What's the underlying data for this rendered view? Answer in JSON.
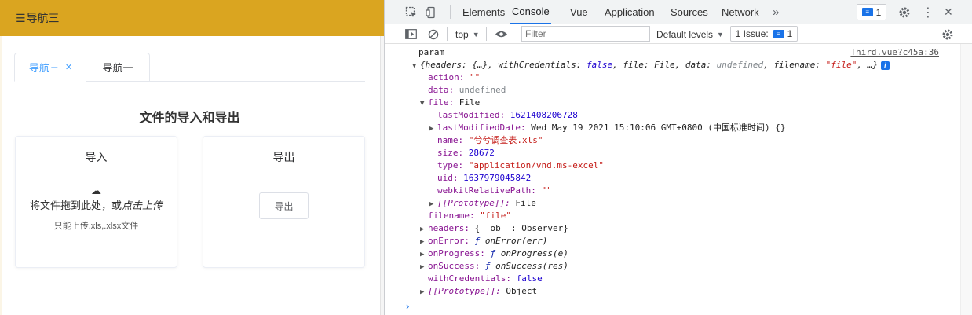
{
  "app": {
    "header_title": "导航三",
    "tabs": [
      {
        "label": "导航三",
        "active": true,
        "closable": true
      },
      {
        "label": "导航一",
        "active": false,
        "closable": false
      }
    ],
    "page_title": "文件的导入和导出",
    "import_card": {
      "title": "导入",
      "drag_text": "将文件拖到此处，或",
      "click_text": "点击上传",
      "tip": "只能上传.xls,.xlsx文件"
    },
    "export_card": {
      "title": "导出",
      "button_label": "导出"
    },
    "colors": {
      "header_bg": "#DAA520",
      "accent": "#409EFF"
    }
  },
  "devtools": {
    "tabs": [
      "Elements",
      "Console",
      "Vue",
      "Application",
      "Sources",
      "Network"
    ],
    "active_tab": "Console",
    "more_label": "»",
    "issues_badge_count": "1",
    "toolbar": {
      "context": "top",
      "filter_placeholder": "Filter",
      "levels": "Default levels",
      "issues_label": "1 Issue:",
      "issues_count": "1"
    },
    "console": {
      "log_label": "param",
      "source_link": "Third.vue?c45a:36",
      "summary": {
        "headers": "headers: {…}",
        "withCredentials_key": "withCredentials:",
        "withCredentials_val": "false",
        "file_key": "file:",
        "file_val": "File",
        "data_key": "data:",
        "data_val": "undefined",
        "filename_key": "filename:",
        "filename_val": "\"file\"",
        "ellipsis": "…}"
      },
      "props": {
        "action_key": "action:",
        "action_val": "\"\"",
        "data_key": "data:",
        "data_val": "undefined",
        "file_key": "file:",
        "file_val": "File",
        "lastModified_key": "lastModified:",
        "lastModified_val": "1621408206728",
        "lastModifiedDate_key": "lastModifiedDate:",
        "lastModifiedDate_val": "Wed May 19 2021 15:10:06 GMT+0800 (中国标准时间) {}",
        "name_key": "name:",
        "name_val": "\"兮兮调查表.xls\"",
        "size_key": "size:",
        "size_val": "28672",
        "type_key": "type:",
        "type_val": "\"application/vnd.ms-excel\"",
        "uid_key": "uid:",
        "uid_val": "1637979045842",
        "webkitRelativePath_key": "webkitRelativePath:",
        "webkitRelativePath_val": "\"\"",
        "proto_file_key": "[[Prototype]]:",
        "proto_file_val": "File",
        "filename_key": "filename:",
        "filename_val": "\"file\"",
        "headers_key": "headers:",
        "headers_val": "{__ob__: Observer}",
        "onError_key": "onError:",
        "onError_val": "onError(err)",
        "onProgress_key": "onProgress:",
        "onProgress_val": "onProgress(e)",
        "onSuccess_key": "onSuccess:",
        "onSuccess_val": "onSuccess(res)",
        "withCredentials_key": "withCredentials:",
        "withCredentials_val": "false",
        "proto_obj_key": "[[Prototype]]:",
        "proto_obj_val": "Object",
        "f_glyph": "ƒ"
      }
    }
  }
}
